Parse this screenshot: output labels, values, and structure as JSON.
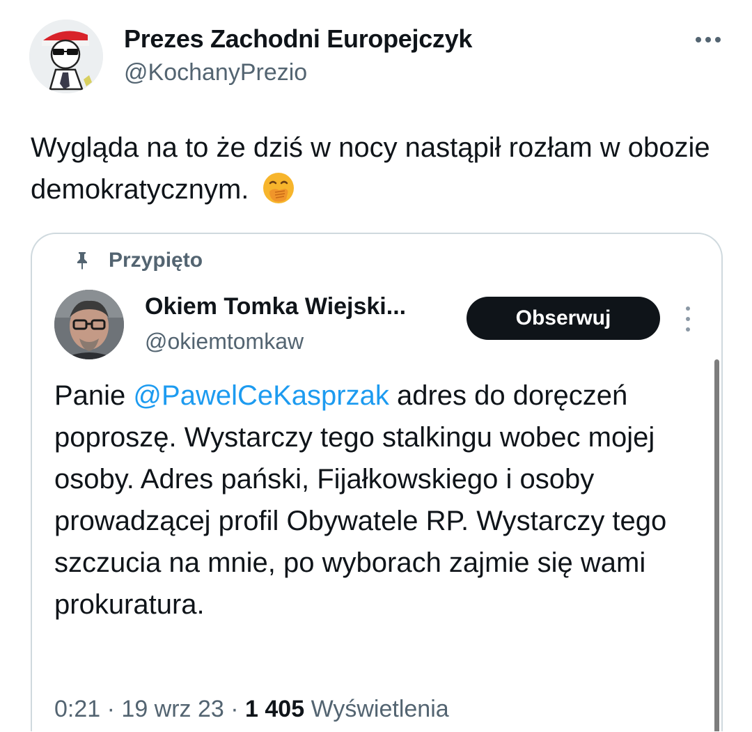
{
  "tweet": {
    "author_name": "Prezes Zachodni Europejczyk",
    "author_handle": "@KochanyPrezio",
    "text": "Wygląda na to że dziś w nocy nastąpił rozłam w obozie demokratycznym.",
    "emoji": "face-with-hand-over-mouth"
  },
  "quote": {
    "pinned_label": "Przypięto",
    "author_name": "Okiem Tomka Wiejski...",
    "author_handle": "@okiemtomkaw",
    "follow_label": "Obserwuj",
    "text_before_mention": "Panie ",
    "mention": "@PawelCeKasprzak",
    "text_after_mention": " adres do doręczeń poproszę. Wystarczy tego stalkingu wobec mojej osoby. Adres pański, Fijałkowskiego i osoby prowadzącej profil Obywatele RP. Wystarczy tego szczucia na mnie, po wyborach zajmie się wami prokuratura.",
    "time": "0:21",
    "date": "19 wrz 23",
    "views_count": "1 405",
    "views_label": "Wyświetlenia"
  },
  "colors": {
    "text": "#0f1419",
    "secondary": "#536471",
    "mention": "#1d9bf0",
    "border": "#cfd9de",
    "button": "#0f1419"
  }
}
